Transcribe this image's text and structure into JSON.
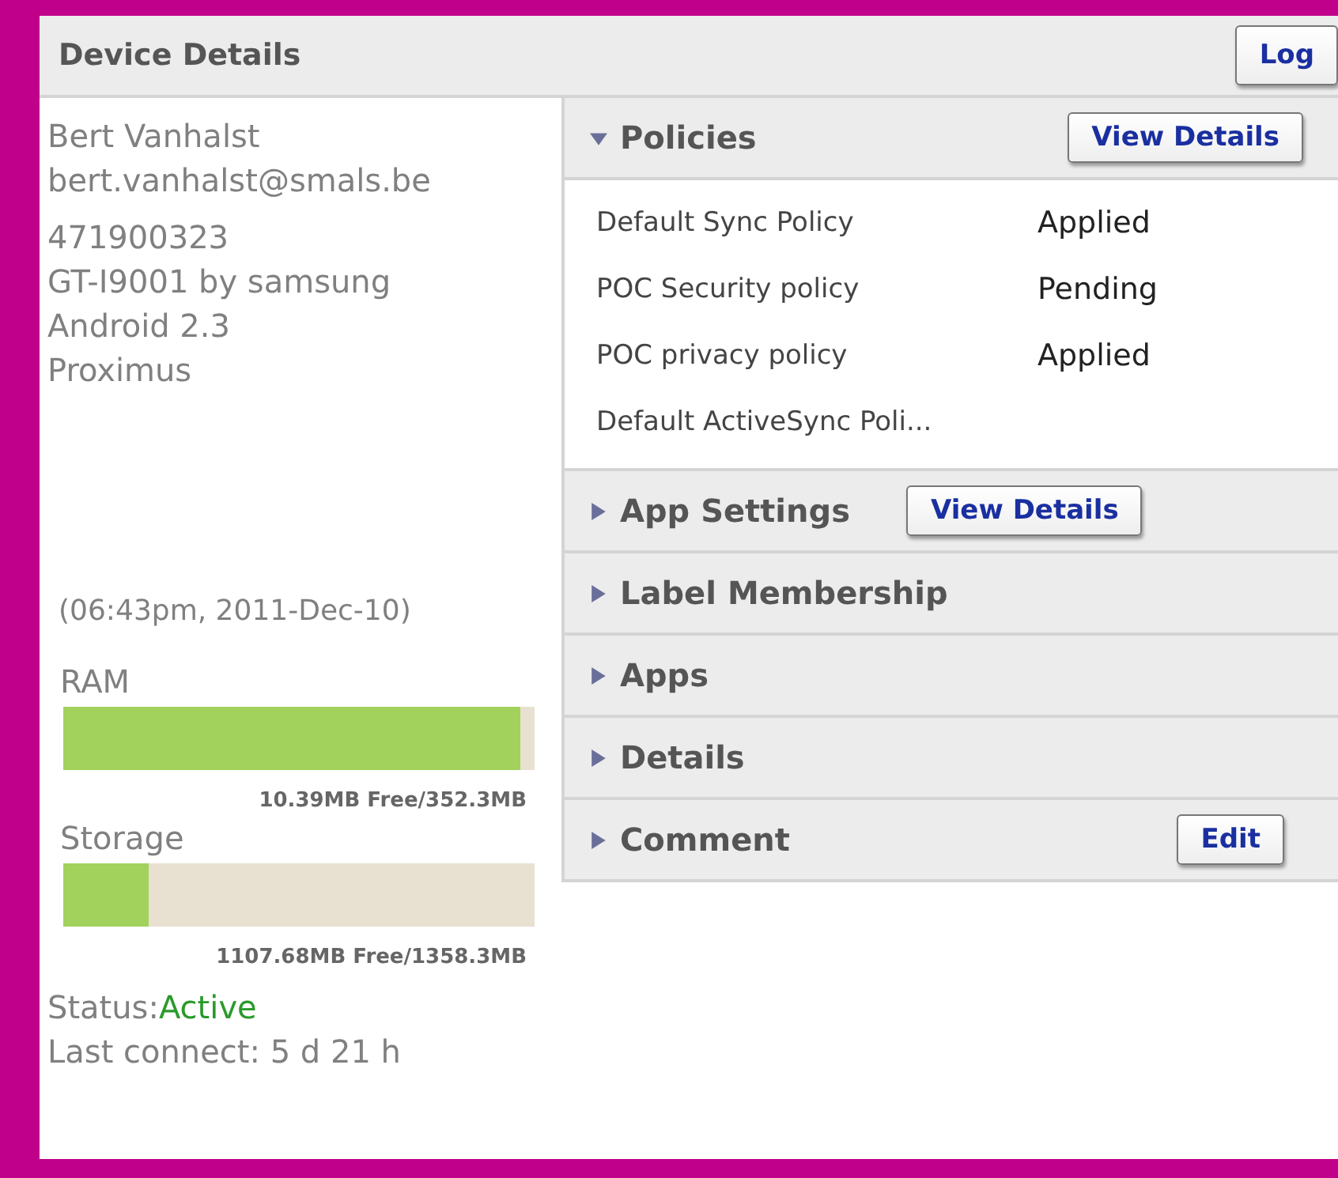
{
  "header": {
    "title": "Device Details",
    "button": "Log"
  },
  "device": {
    "name": "Bert Vanhalst",
    "email": "bert.vanhalst@smals.be",
    "info": [
      "471900323",
      "GT-I9001 by samsung",
      "Android 2.3",
      "Proximus"
    ],
    "timestamp": "(06:43pm, 2011-Dec-10)",
    "meters": [
      {
        "label": "RAM",
        "level": 0.97,
        "reading": "10.39MB Free/352.3MB"
      },
      {
        "label": "Storage",
        "level": 0.18,
        "reading": "1107.68MB Free/1358.3MB"
      }
    ],
    "status_label": "Status:",
    "status": "Active",
    "last_connect": "Last connect: 5 d 21 h"
  },
  "sections": [
    {
      "title": "Policies",
      "expanded": true,
      "button": "View Details",
      "rows": [
        {
          "name": "Default Sync Policy",
          "state": "Applied"
        },
        {
          "name": "POC Security policy",
          "state": "Pending"
        },
        {
          "name": "POC privacy policy",
          "state": "Applied"
        },
        {
          "name": "Default ActiveSync Poli..."
        }
      ]
    },
    {
      "title": "App Settings",
      "expanded": false,
      "button": "View Details"
    },
    {
      "title": "Label Membership",
      "expanded": false
    },
    {
      "title": "Apps",
      "expanded": false
    },
    {
      "title": "Details",
      "expanded": false
    },
    {
      "title": "Comment",
      "expanded": false,
      "button": "Edit"
    }
  ]
}
